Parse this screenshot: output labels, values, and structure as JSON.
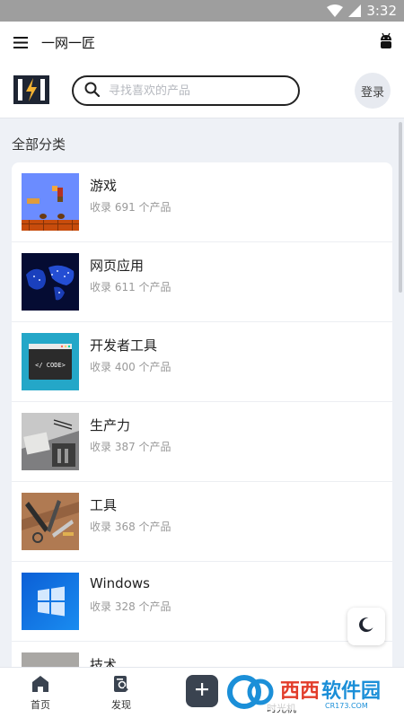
{
  "status": {
    "time": "3:32"
  },
  "app": {
    "title": "一网一匠"
  },
  "search": {
    "placeholder": "寻找喜欢的产品"
  },
  "header": {
    "login_label": "登录"
  },
  "section": {
    "title": "全部分类"
  },
  "categories": [
    {
      "name": "游戏",
      "count": "收录 691 个产品"
    },
    {
      "name": "网页应用",
      "count": "收录 611 个产品"
    },
    {
      "name": "开发者工具",
      "count": "收录 400 个产品"
    },
    {
      "name": "生产力",
      "count": "收录 387 个产品"
    },
    {
      "name": "工具",
      "count": "收录 368 个产品"
    },
    {
      "name": "Windows",
      "count": "收录 328 个产品"
    },
    {
      "name": "技术",
      "count": ""
    }
  ],
  "thumb_text": {
    "code": "</ CODE>"
  },
  "nav": {
    "home": "首页",
    "discover": "发现",
    "partial": "时光机"
  },
  "watermark": {
    "brand": "西西软件园",
    "domain": "CR173.COM"
  },
  "colors": {
    "accent": "#3a4350",
    "background": "#eef1f6"
  }
}
